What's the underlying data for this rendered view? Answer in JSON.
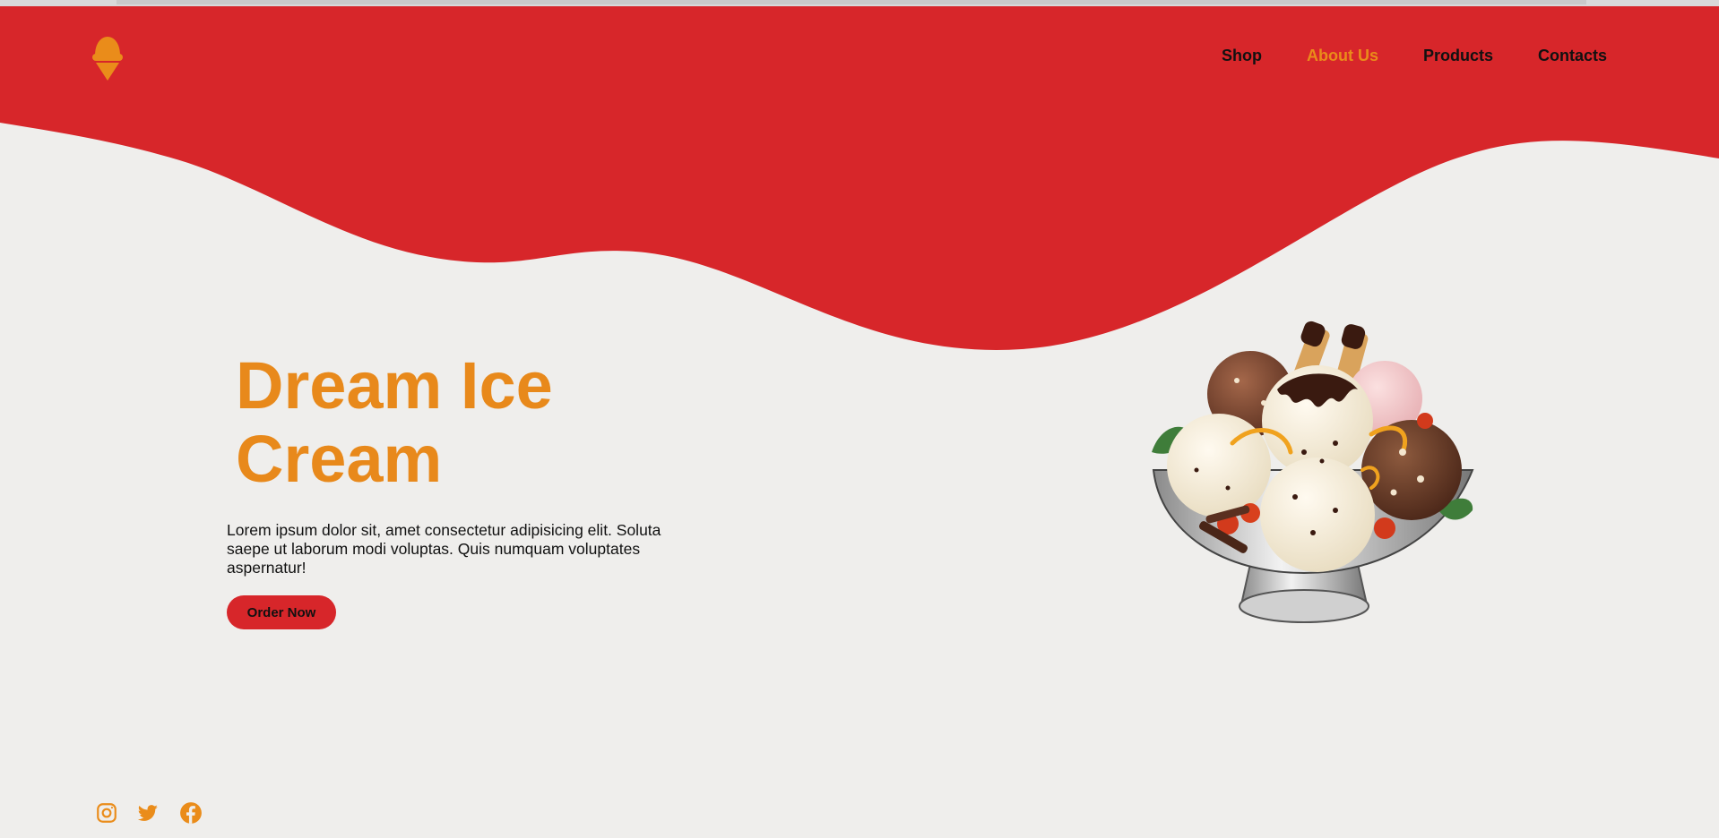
{
  "nav": {
    "items": [
      {
        "label": "Shop",
        "active": false
      },
      {
        "label": "About Us",
        "active": true
      },
      {
        "label": "Products",
        "active": false
      },
      {
        "label": "Contacts",
        "active": false
      }
    ]
  },
  "hero": {
    "title_line1": "Dream Ice",
    "title_line2": "Cream",
    "text": "Lorem ipsum dolor sit, amet consectetur adipisicing elit. Soluta saepe ut laborum modi voluptas. Quis numquam voluptates aspernatur!",
    "button_label": "Order Now"
  },
  "social": {
    "icons": [
      "instagram-icon",
      "twitter-icon",
      "facebook-icon"
    ]
  },
  "colors": {
    "brand_red": "#d7262a",
    "accent_orange": "#e8891b",
    "background": "#efeeec"
  }
}
